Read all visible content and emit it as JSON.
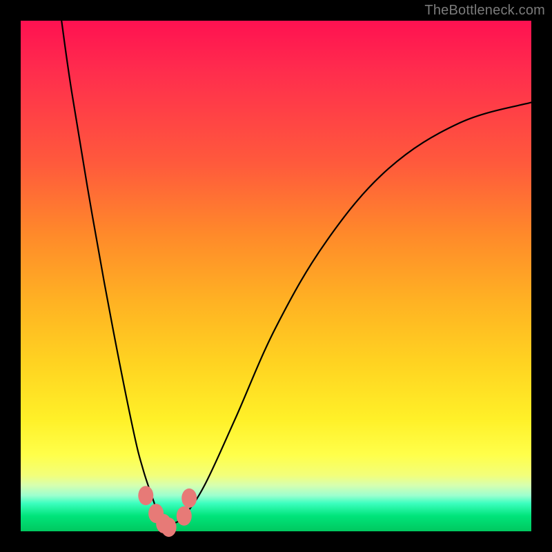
{
  "watermark": "TheBottleneck.com",
  "chart_data": {
    "type": "line",
    "title": "",
    "xlabel": "",
    "ylabel": "",
    "xlim": [
      0,
      100
    ],
    "ylim": [
      0,
      100
    ],
    "x": [
      8,
      10,
      14,
      18,
      22,
      24,
      26,
      27,
      28,
      29,
      30,
      32,
      36,
      42,
      50,
      60,
      72,
      86,
      100
    ],
    "y": [
      100,
      86,
      62,
      40,
      20,
      12,
      6,
      3,
      1.5,
      0.8,
      1.5,
      3,
      9,
      22,
      40,
      57,
      71,
      80,
      84
    ],
    "curve_color": "#000000",
    "markers": [
      {
        "x": 24.5,
        "y": 7.0
      },
      {
        "x": 26.5,
        "y": 3.5
      },
      {
        "x": 28.0,
        "y": 1.5
      },
      {
        "x": 29.0,
        "y": 0.8
      },
      {
        "x": 32.0,
        "y": 3.0
      },
      {
        "x": 33.0,
        "y": 6.5
      }
    ],
    "marker_color": "#e77a77",
    "background_gradient": [
      {
        "stop": 0.0,
        "color": "#ff1151"
      },
      {
        "stop": 0.28,
        "color": "#ff5a3c"
      },
      {
        "stop": 0.55,
        "color": "#ffb223"
      },
      {
        "stop": 0.85,
        "color": "#ffff4a"
      },
      {
        "stop": 0.94,
        "color": "#3cffbf"
      },
      {
        "stop": 1.0,
        "color": "#00c85f"
      }
    ]
  }
}
